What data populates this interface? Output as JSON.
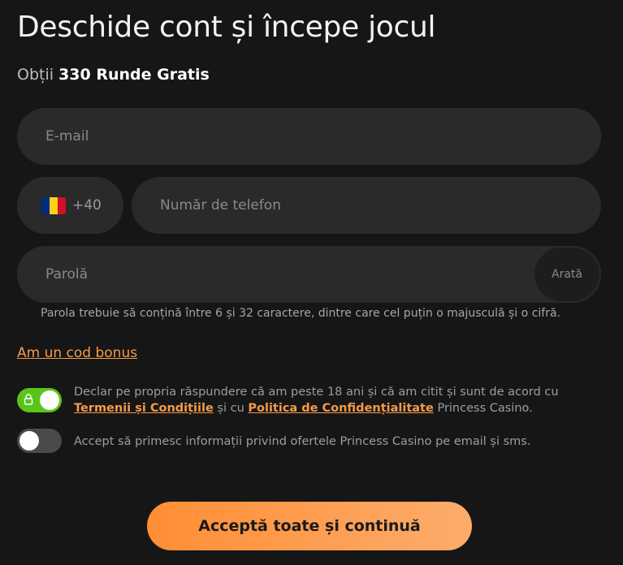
{
  "header": {
    "title": "Deschide cont și începe jocul",
    "subtitle_prefix": "Obții",
    "subtitle_bold": "330 Runde Gratis"
  },
  "form": {
    "email_placeholder": "E-mail",
    "phone_prefix": "+40",
    "phone_flag": "romania-flag",
    "phone_placeholder": "Număr de telefon",
    "password_placeholder": "Parolă",
    "show_password_label": "Arată",
    "password_hint": "Parola trebuie să conțină între 6 și 32 caractere, dintre care cel puțin o majusculă și o cifră.",
    "bonus_code_link": "Am un cod bonus"
  },
  "consents": {
    "terms": {
      "checked": true,
      "text_before": "Declar pe propria răspundere că am peste 18 ani și că am citit și sunt de acord cu",
      "link1": "Termenii și Condițiile",
      "text_middle": "și cu",
      "link2": "Politica de Confidențialitate",
      "text_after": "Princess Casino."
    },
    "marketing": {
      "checked": false,
      "text": "Accept să primesc informații privind ofertele Princess Casino pe email și sms."
    }
  },
  "cta": {
    "label": "Acceptă toate și continuă"
  },
  "colors": {
    "background": "#161616",
    "field": "#2a2a2a",
    "accent": "#f59a4a",
    "toggle_on": "#5ac41a",
    "toggle_off": "#4a4a4a",
    "cta_start": "#ff8e35",
    "cta_end": "#fcac6c"
  },
  "flag_colors": [
    "#002b7f",
    "#fcd116",
    "#ce1126"
  ]
}
